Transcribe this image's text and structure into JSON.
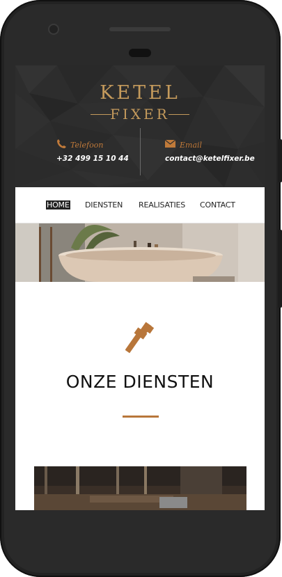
{
  "brand": {
    "logo_line1": "KETEL",
    "logo_line2": "FIXER",
    "accent_color": "#c49a5c",
    "copper_color": "#b8763a"
  },
  "contact": {
    "phone_label": "Telefoon",
    "phone_value": "+32 499 15 10 44",
    "phone_icon": "phone-icon",
    "email_label": "Email",
    "email_value": "contact@ketelfixer.be",
    "email_icon": "envelope-icon"
  },
  "nav": {
    "items": [
      {
        "label": "HOME",
        "active": true
      },
      {
        "label": "DIENSTEN",
        "active": false
      },
      {
        "label": "REALISATIES",
        "active": false
      },
      {
        "label": "CONTACT",
        "active": false
      }
    ]
  },
  "main": {
    "section_icon": "wrench-icon",
    "section_title": "ONZE DIENSTEN"
  }
}
